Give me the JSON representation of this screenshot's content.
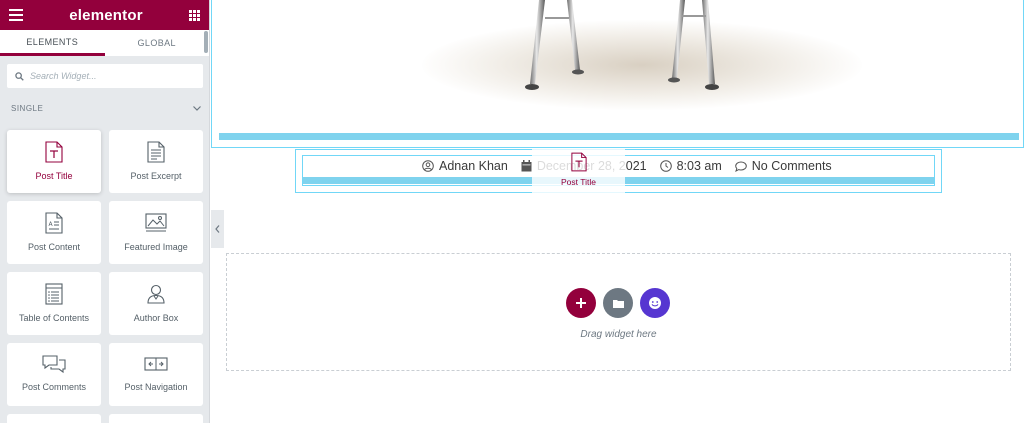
{
  "sidebar": {
    "logo": "elementor",
    "tabs": [
      {
        "label": "ELEMENTS",
        "active": true
      },
      {
        "label": "GLOBAL",
        "active": false
      }
    ],
    "search_placeholder": "Search Widget...",
    "category": "SINGLE",
    "widgets": [
      {
        "label": "Post Title",
        "icon": "post-title-icon"
      },
      {
        "label": "Post Excerpt",
        "icon": "post-excerpt-icon"
      },
      {
        "label": "Post Content",
        "icon": "post-content-icon"
      },
      {
        "label": "Featured Image",
        "icon": "featured-image-icon"
      },
      {
        "label": "Table of Contents",
        "icon": "table-of-contents-icon"
      },
      {
        "label": "Author Box",
        "icon": "author-box-icon"
      },
      {
        "label": "Post Comments",
        "icon": "post-comments-icon"
      },
      {
        "label": "Post Navigation",
        "icon": "post-navigation-icon"
      }
    ]
  },
  "preview": {
    "meta": {
      "author": "Adnan Khan",
      "date": "December 28, 2021",
      "time": "8:03 am",
      "comments": "No Comments"
    },
    "drag_ghost_label": "Post Title",
    "dropzone_text": "Drag widget here"
  },
  "colors": {
    "brand": "#93003c",
    "highlight": "#71d7f7",
    "kit": "#5636d1",
    "template": "#6d7882"
  }
}
